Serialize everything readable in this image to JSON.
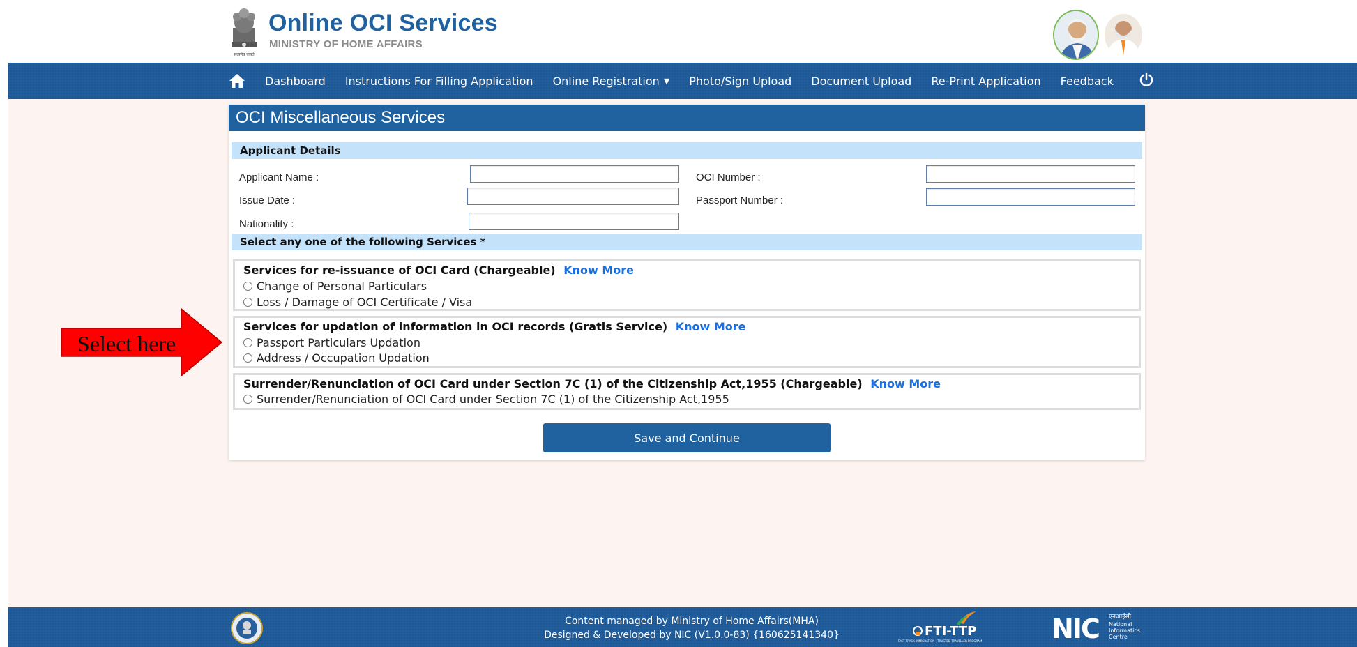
{
  "header": {
    "title": "Online OCI Services",
    "subtitle": "MINISTRY OF HOME AFFAIRS",
    "emblem_caption": "सत्यमेव जयते"
  },
  "nav": {
    "items": [
      {
        "label": "Dashboard"
      },
      {
        "label": "Instructions For Filling Application"
      },
      {
        "label": "Online Registration"
      },
      {
        "label": "Photo/Sign Upload"
      },
      {
        "label": "Document Upload"
      },
      {
        "label": "Re-Print Application"
      },
      {
        "label": "Feedback"
      }
    ]
  },
  "panel": {
    "title": "OCI Miscellaneous Services",
    "applicant_section": "Applicant Details",
    "fields": {
      "applicant_name": {
        "label": "Applicant Name :",
        "value": ""
      },
      "oci_number": {
        "label": "OCI Number :",
        "value": ""
      },
      "issue_date": {
        "label": "Issue Date :",
        "value": ""
      },
      "passport_number": {
        "label": "Passport Number :",
        "value": ""
      },
      "nationality": {
        "label": "Nationality :",
        "value": ""
      }
    },
    "services_section": "Select any one of the following Services *",
    "groups": [
      {
        "heading": "Services for re-issuance of OCI Card (Chargeable)",
        "know_more": "Know More",
        "options": [
          "Change of Personal Particulars",
          "Loss / Damage of OCI Certificate / Visa"
        ]
      },
      {
        "heading": "Services for updation of information in OCI records (Gratis Service)",
        "know_more": "Know More",
        "options": [
          "Passport Particulars Updation",
          "Address / Occupation Updation"
        ]
      },
      {
        "heading": "Surrender/Renunciation of OCI Card under Section 7C (1) of the Citizenship Act,1955 (Chargeable)",
        "know_more": "Know More",
        "options": [
          "Surrender/Renunciation of OCI Card under Section 7C (1) of the Citizenship Act,1955"
        ]
      }
    ],
    "save_label": "Save and Continue"
  },
  "annotation": {
    "text": "Select here",
    "color": "#ff0000"
  },
  "footer": {
    "line1": "Content managed by Ministry of Home Affairs(MHA)",
    "line2": "Designed & Developed by NIC (V1.0.0-83) {160625141340}",
    "fti_label": "FTI-TTP",
    "fti_sub": "FAST TRACK IMMIGRATION - TRUSTED TRAVELLER PROGRAM",
    "nic_label": "NIC",
    "nic_hindi": "एनआईसी",
    "nic_line1": "National",
    "nic_line2": "Informatics",
    "nic_line3": "Centre"
  },
  "colors": {
    "brand_blue": "#2062a0",
    "section_blue": "#c5e2fb",
    "link_blue": "#1a6fe0"
  }
}
